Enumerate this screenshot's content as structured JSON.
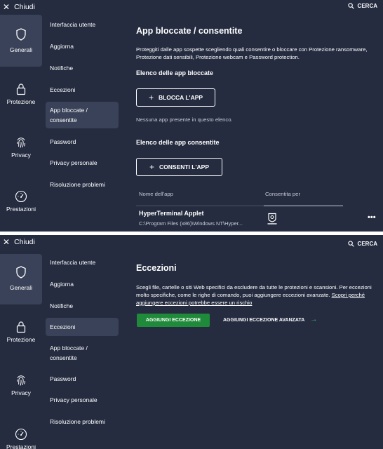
{
  "close_label": "Chiudi",
  "search_label": "CERCA",
  "categories": [
    {
      "label": "Generali",
      "icon": "shield-icon"
    },
    {
      "label": "Protezione",
      "icon": "lock-icon"
    },
    {
      "label": "Privacy",
      "icon": "fingerprint-icon"
    },
    {
      "label": "Prestazioni",
      "icon": "speedometer-icon"
    }
  ],
  "subnav": [
    {
      "label": "Interfaccia utente"
    },
    {
      "label": "Aggiorna"
    },
    {
      "label": "Notifiche"
    },
    {
      "label": "Eccezioni"
    },
    {
      "label": "App bloccate /",
      "label2": "consentite"
    },
    {
      "label": "Password"
    },
    {
      "label": "Privacy personale"
    },
    {
      "label": "Risoluzione problemi"
    }
  ],
  "panel1": {
    "title": "App bloccate / consentite",
    "description": "Proteggiti dalle app sospette scegliendo quali consentire o bloccare con Protezione ransomware, Protezione dati sensibili, Protezione webcam e Password protection.",
    "blocked_heading": "Elenco delle app bloccate",
    "block_button": "BLOCCA L'APP",
    "blocked_empty": "Nessuna app presente in questo elenco.",
    "allowed_heading": "Elenco delle app consentite",
    "allow_button": "CONSENTI L'APP",
    "columns": [
      "Nome dell'app",
      "Consentita per"
    ],
    "rows": [
      {
        "name": "HyperTerminal Applet",
        "path": "C:\\Program Files (x86)\\Windows NT\\Hyper...",
        "permission_icon": "webcam-shield-icon"
      }
    ]
  },
  "panel2": {
    "title": "Eccezioni",
    "description": "Scegli file, cartelle o siti Web specifici da escludere da tutte le protezioni e scansioni. Per eccezioni molto specifiche, come le righe di comando, puoi aggiungere eccezioni avanzate.",
    "learn_more": "Scopri perché aggiungere eccezioni potrebbe essere un rischio",
    "add_button": "AGGIUNGI ECCEZIONE",
    "add_advanced": "AGGIUNGI ECCEZIONE AVANZATA"
  },
  "colors": {
    "background": "#252c40",
    "active": "#394258",
    "accent_green": "#1f8a3a",
    "arrow_green": "#3ec35f"
  }
}
